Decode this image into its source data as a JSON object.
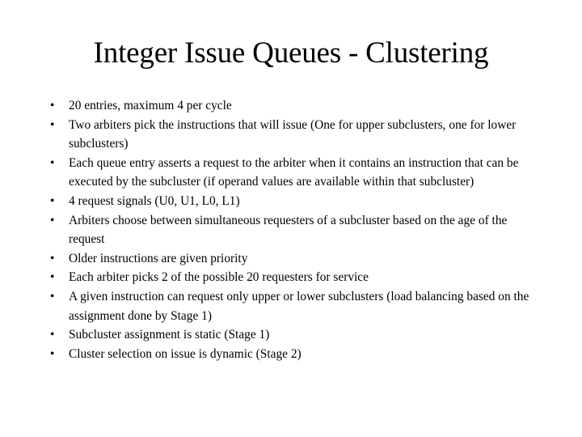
{
  "slide": {
    "title": "Integer Issue Queues - Clustering",
    "background_color": "#ffffff",
    "text_color": "#000000",
    "bullet_glyph": "•",
    "bullets": [
      {
        "text": "20 entries, maximum 4 per cycle"
      },
      {
        "text": "Two arbiters pick the instructions that will issue (One for upper subclusters, one for lower subclusters)"
      },
      {
        "text": "Each queue entry asserts a request to the arbiter when it contains an instruction that can be executed by the subcluster (if operand values are available within that subcluster)"
      },
      {
        "text": "4 request signals (U0, U1, L0, L1)"
      },
      {
        "text": "Arbiters choose between simultaneous requesters of a subcluster based on the age of the request"
      },
      {
        "text": "Older instructions are given priority"
      },
      {
        "text": "Each arbiter picks 2 of the possible 20 requesters for service"
      },
      {
        "text": "A given instruction can request only upper or lower subclusters (load balancing based on the assignment done by Stage 1)"
      },
      {
        "text": "Subcluster assignment is static (Stage 1)"
      },
      {
        "text": "Cluster selection on issue is dynamic (Stage 2)"
      }
    ]
  }
}
